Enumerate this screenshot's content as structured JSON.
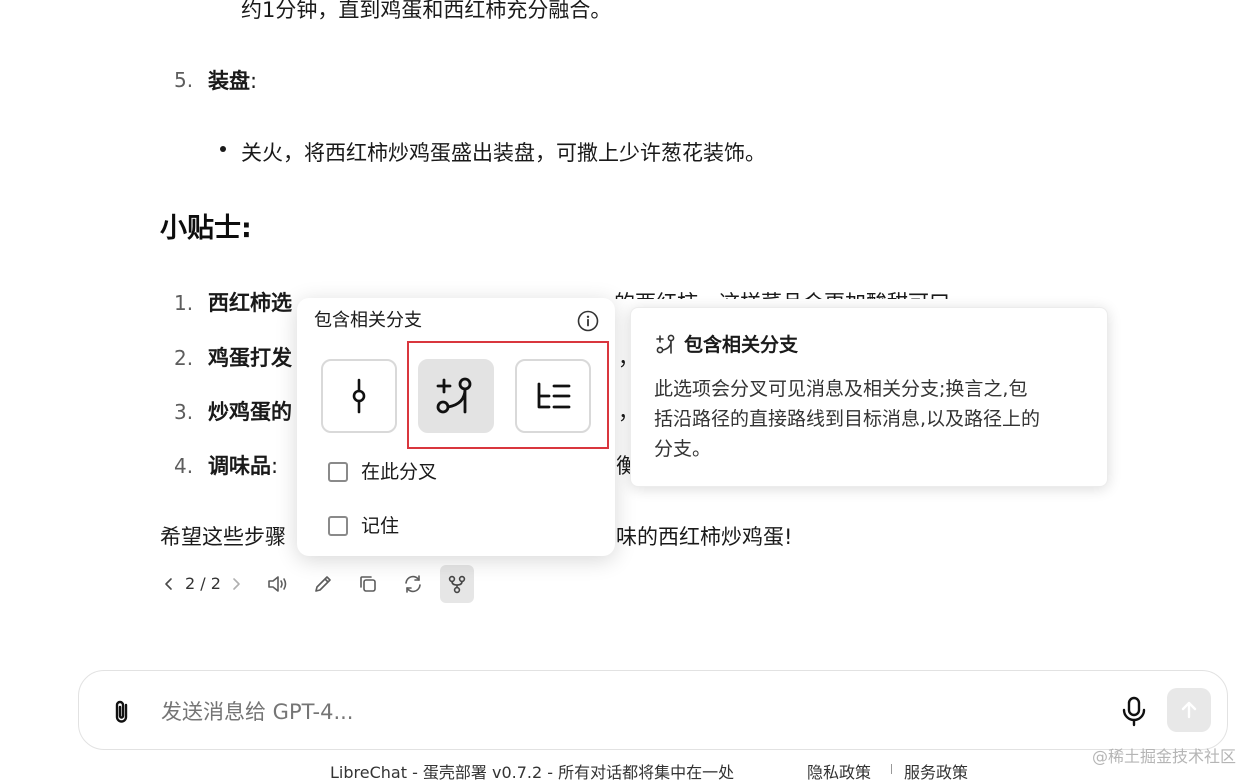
{
  "content": {
    "step4_tail": "约1分钟，直到鸡蛋和西红柿充分融合。",
    "step5": {
      "number": "5.",
      "title": "装盘",
      "colon": ":",
      "bullet": "关火，将西红柿炒鸡蛋盛出装盘，可撒上少许葱花装饰。"
    },
    "tips_heading": "小贴士:",
    "tips": [
      {
        "number": "1.",
        "title": "西红柿选",
        "tail": "的西红柿，这样菜品会更加酸甜可口"
      },
      {
        "number": "2.",
        "title": "鸡蛋打发",
        "tail": "，"
      },
      {
        "number": "3.",
        "title": "炒鸡蛋的",
        "tail": "，"
      },
      {
        "number": "4.",
        "title": "调味品",
        "colon": ":",
        "tail": "衡"
      }
    ],
    "closing_left": "希望这些步骤",
    "closing_right": "味的西红柿炒鸡蛋!"
  },
  "message_actions": {
    "pager": "2 / 2",
    "icons": [
      "chevron-left-icon",
      "chevron-right-icon",
      "speaker-icon",
      "pencil-icon",
      "copy-icon",
      "regenerate-icon",
      "fork-icon"
    ]
  },
  "fork_popover": {
    "title": "包含相关分支",
    "options": [
      "visible-messages-only",
      "include-related-branches",
      "include-all-to-target"
    ],
    "selected_option": "include-related-branches",
    "checkbox_branch_here": "在此分叉",
    "checkbox_remember": "记住"
  },
  "tooltip": {
    "title": "包含相关分支",
    "line1": "此选项会分叉可见消息及相关分支;换言之,包",
    "line2": "括沿路径的直接路线到目标消息,以及路径上的",
    "line3": "分支。"
  },
  "composer": {
    "placeholder": "发送消息给 GPT-4..."
  },
  "footer": {
    "text": "LibreChat - 蛋壳部署 v0.7.2 - 所有对话都将集中在一处",
    "privacy": "隐私政策",
    "terms": "服务政策",
    "watermark": "@稀土掘金技术社区"
  },
  "colors": {
    "highlight_box": "#d9363e",
    "selected_bg": "#e3e3e3",
    "send_button_bg": "#e8e8e8"
  }
}
